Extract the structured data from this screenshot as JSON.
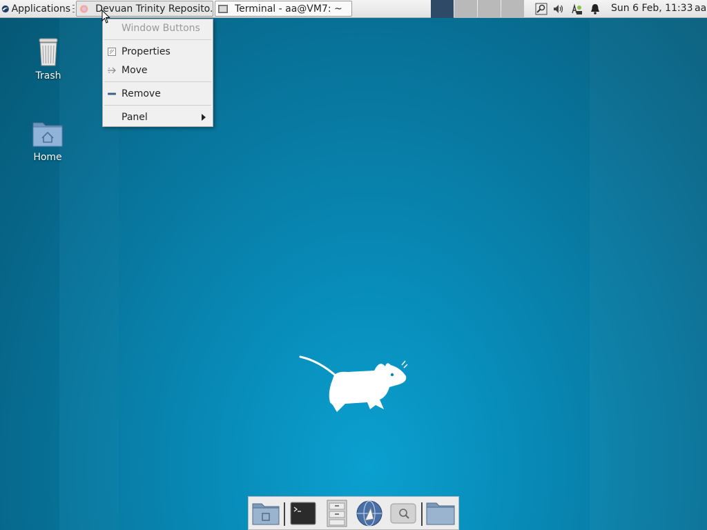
{
  "panel": {
    "applications_label": "Applications",
    "tasks": [
      {
        "label": "Devuan Trinity Reposito...",
        "icon": "firefox-icon"
      },
      {
        "label": "Terminal - aa@VM7: ~",
        "icon": "terminal-icon"
      }
    ],
    "clock": "Sun  6 Feb, 11:33",
    "user": "aa",
    "tray": [
      "search-icon",
      "volume-icon",
      "network-icon",
      "bell-icon"
    ]
  },
  "desktop": {
    "icons": [
      {
        "label": "Trash",
        "icon": "trash-icon"
      },
      {
        "label": "Home",
        "icon": "home-folder-icon"
      }
    ]
  },
  "context_menu": {
    "title": "Window Buttons",
    "items": [
      {
        "label": "Properties",
        "icon": "properties-icon"
      },
      {
        "label": "Move",
        "icon": "move-icon"
      },
      {
        "label": "Remove",
        "icon": "remove-icon"
      },
      {
        "label": "Panel",
        "icon": "submenu-arrow-icon"
      }
    ]
  },
  "dock": {
    "items": [
      "show-desktop",
      "terminal",
      "file-manager",
      "web-browser",
      "app-finder",
      "folder"
    ]
  },
  "colors": {
    "desktop_bg": "#0887b3",
    "panel_bg": "#e6e6e6",
    "workspace_active": "#2e4a66",
    "workspace_inactive": "#b9b9b9"
  }
}
